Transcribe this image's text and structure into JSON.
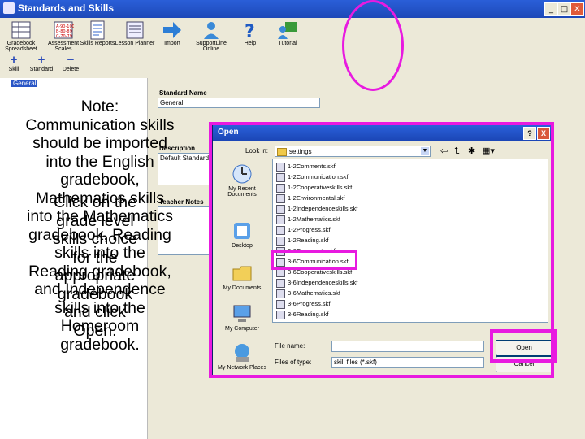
{
  "window": {
    "title": "Standards and Skills",
    "min": "_",
    "max": "□",
    "close": "✕"
  },
  "toolbar": [
    {
      "label": "Gradebook Spreadsheet",
      "icon": "spreadsheet-icon"
    },
    {
      "label": "Assessment Scales",
      "icon": "scales-icon"
    },
    {
      "label": "Skills Reports",
      "icon": "report-icon"
    },
    {
      "label": "Lesson Planner",
      "icon": "planner-icon"
    },
    {
      "label": "Import",
      "icon": "import-arrow-icon"
    },
    {
      "label": "SupportLine Online",
      "icon": "support-person-icon"
    },
    {
      "label": "Help",
      "icon": "help-icon"
    },
    {
      "label": "Tutorial",
      "icon": "tutorial-icon"
    }
  ],
  "toolbar2": [
    {
      "symbol": "+",
      "label": "Skill"
    },
    {
      "symbol": "+",
      "label": "Standard"
    },
    {
      "symbol": "−",
      "label": "Delete"
    }
  ],
  "left": {
    "general_tag": "General"
  },
  "note": "Note:\nCommunication skills\nshould be imported\ninto the English\ngradebook,\nMathematics skills\ninto the Mathematics\ngradebook, Reading\nskills into the\nReading gradebook,\nand Independence\nskills into the\nHomeroom\ngradebook.",
  "click_note": "Click on the\ngrade level\nskills choice\nfor the\nappropriate\ngradebook\nand click\nOpen.",
  "form": {
    "standard_name_label": "Standard Name",
    "standard_name_value": "General",
    "description_label": "Description",
    "description_value": "Default Standard",
    "teacher_notes_label": "Teacher Notes"
  },
  "dialog": {
    "title": "Open",
    "help": "?",
    "close": "X",
    "look_in_label": "Look in:",
    "look_in_value": "settings",
    "places": [
      {
        "label": "My Recent Documents",
        "icon": "recent-documents-icon"
      },
      {
        "label": "Desktop",
        "icon": "desktop-icon"
      },
      {
        "label": "My Documents",
        "icon": "my-documents-icon"
      },
      {
        "label": "My Computer",
        "icon": "my-computer-icon"
      },
      {
        "label": "My Network Places",
        "icon": "network-places-icon"
      }
    ],
    "files": [
      "1-2Comments.skf",
      "1-2Communication.skf",
      "1-2Cooperativeskills.skf",
      "1-2Environmental.skf",
      "1-2Independenceskills.skf",
      "1-2Mathematics.skf",
      "1-2Progress.skf",
      "1-2Reading.skf",
      "3-6Comments.skf",
      "3-6Communication.skf",
      "3-6Cooperativeskills.skf",
      "3-6Independenceskills.skf",
      "3-6Mathematics.skf",
      "3-6Progress.skf",
      "3-6Reading.skf"
    ],
    "file_name_label": "File name:",
    "file_name_value": "",
    "file_type_label": "Files of type:",
    "file_type_value": "skill files (*.skf)",
    "open_button": "Open",
    "cancel_button": "Cancel"
  },
  "colors": {
    "highlight": "#e81ae0",
    "titlebar": "#2a5fd8"
  }
}
